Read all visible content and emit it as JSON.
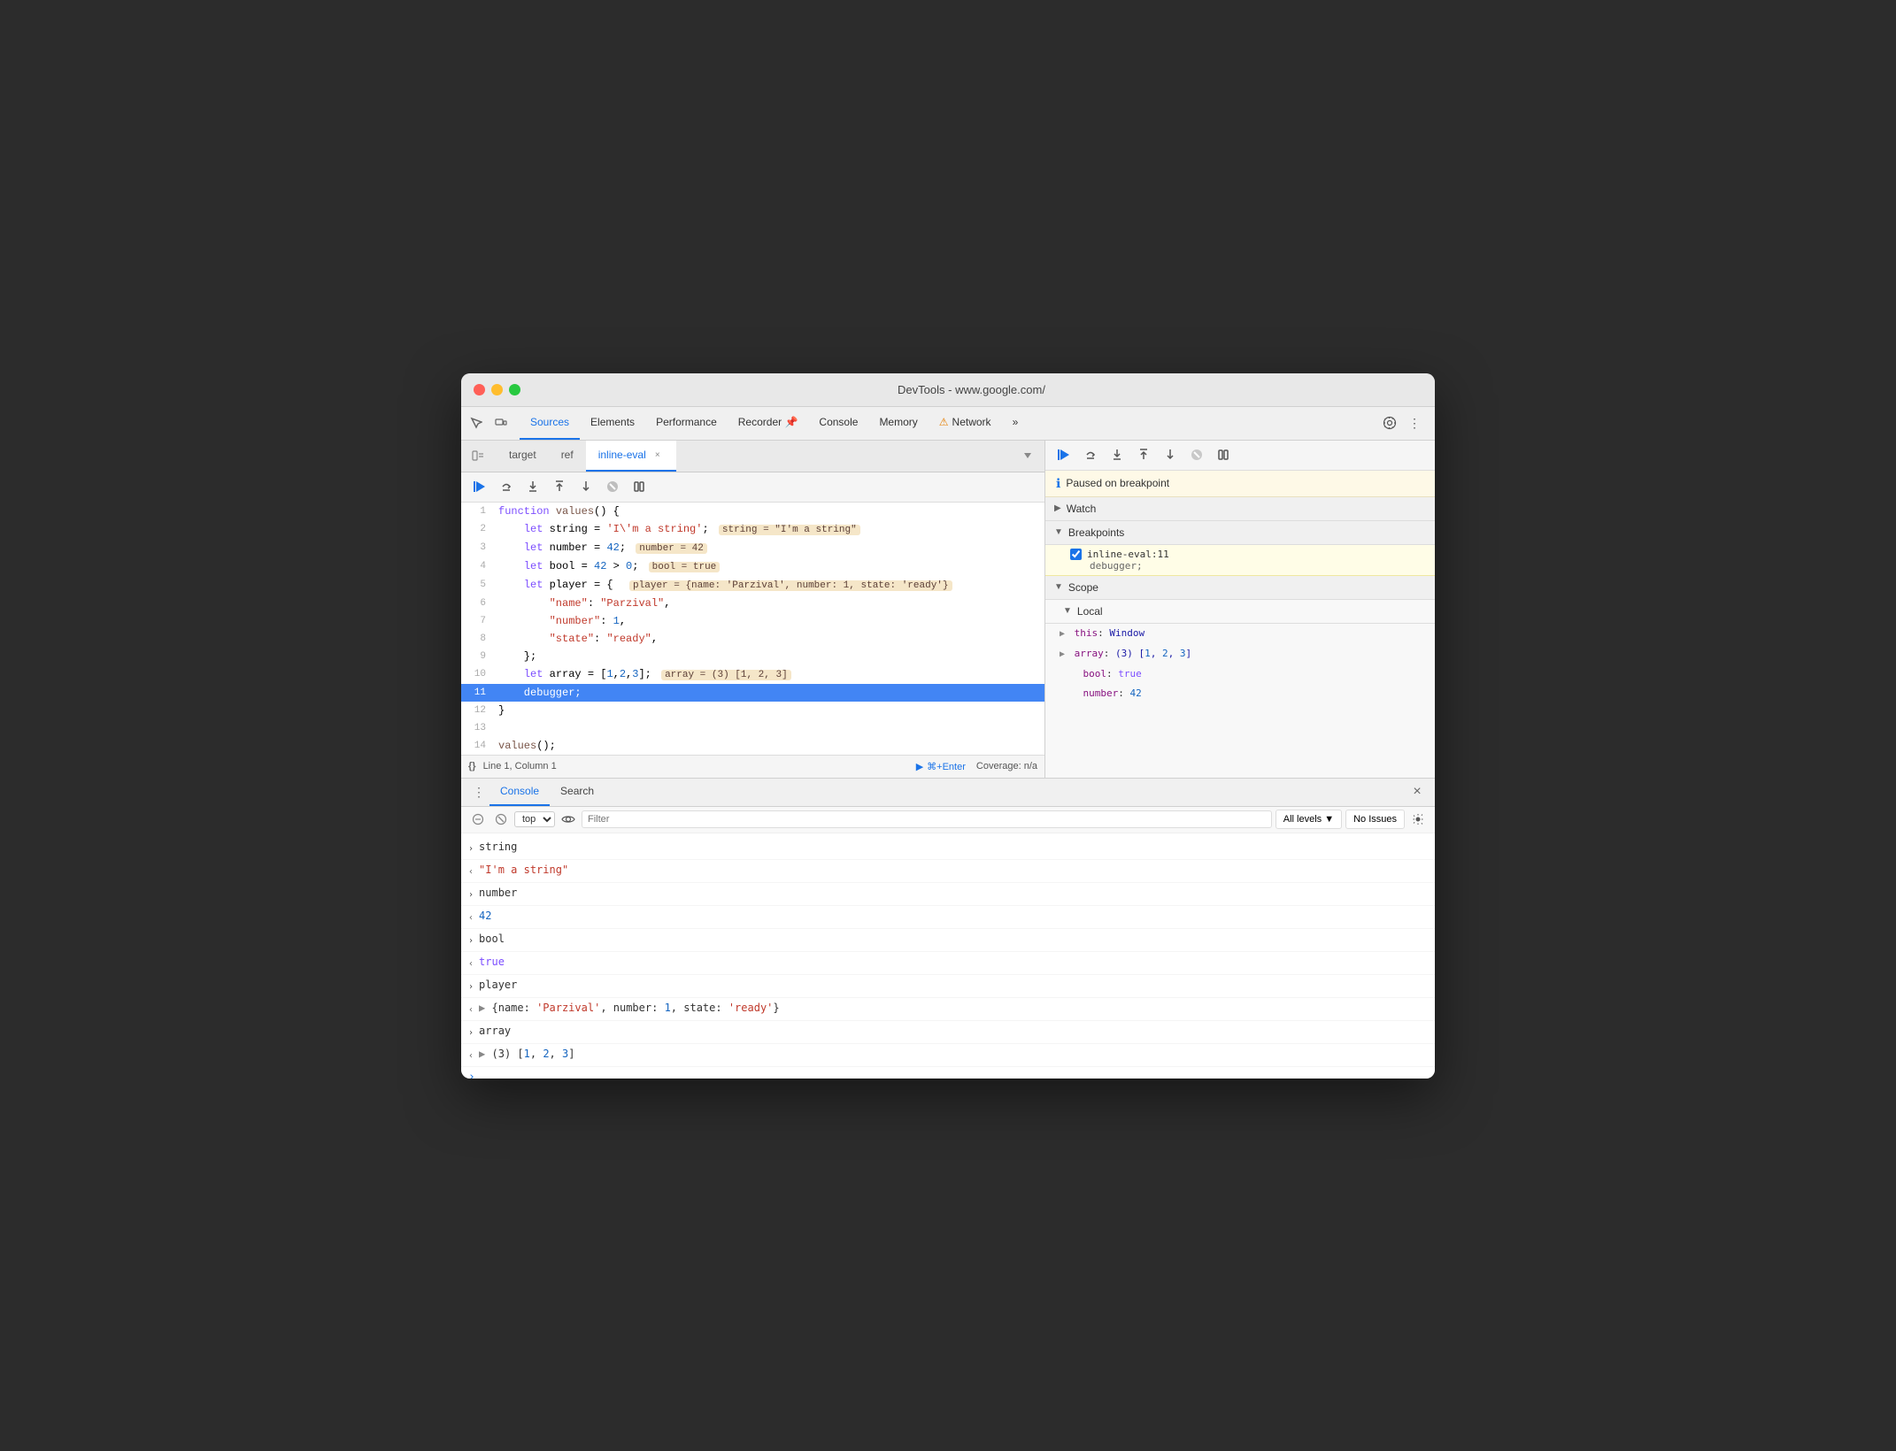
{
  "window": {
    "title": "DevTools - www.google.com/"
  },
  "traffic_lights": {
    "close": "close",
    "minimize": "minimize",
    "maximize": "maximize"
  },
  "devtools_tabs": {
    "items": [
      {
        "label": "Sources",
        "active": true
      },
      {
        "label": "Elements",
        "active": false
      },
      {
        "label": "Performance",
        "active": false
      },
      {
        "label": "Recorder",
        "active": false,
        "icon": "📌"
      },
      {
        "label": "Console",
        "active": false
      },
      {
        "label": "Memory",
        "active": false
      },
      {
        "label": "Network",
        "active": false,
        "warning": true
      },
      {
        "label": "»",
        "active": false
      }
    ]
  },
  "source_tabs": {
    "items": [
      {
        "label": "target",
        "closeable": false
      },
      {
        "label": "ref",
        "closeable": false
      },
      {
        "label": "inline-eval",
        "closeable": true,
        "active": true
      }
    ]
  },
  "debug_toolbar": {
    "resume_label": "Resume",
    "step_over_label": "Step over",
    "step_into_label": "Step into",
    "step_out_label": "Step out",
    "step_label": "Step",
    "deactivate_label": "Deactivate breakpoints",
    "pause_exceptions_label": "Pause on exceptions"
  },
  "code": {
    "lines": [
      {
        "num": 1,
        "content": "function values() {",
        "current": false
      },
      {
        "num": 2,
        "content": "    let string = 'I\\'m a string';",
        "current": false,
        "inline": "string = \"I'm a string\""
      },
      {
        "num": 3,
        "content": "    let number = 42;",
        "current": false,
        "inline": "number = 42"
      },
      {
        "num": 4,
        "content": "    let bool = 42 > 0;",
        "current": false,
        "inline": "bool = true"
      },
      {
        "num": 5,
        "content": "    let player = {  player = {name: 'Parzival', number: 1, state: 'ready'}",
        "current": false
      },
      {
        "num": 6,
        "content": "        \"name\": \"Parzival\",",
        "current": false
      },
      {
        "num": 7,
        "content": "        \"number\": 1,",
        "current": false
      },
      {
        "num": 8,
        "content": "        \"state\": \"ready\",",
        "current": false
      },
      {
        "num": 9,
        "content": "    };",
        "current": false
      },
      {
        "num": 10,
        "content": "    let array = [1,2,3];",
        "current": false,
        "inline": "array = (3) [1, 2, 3]"
      },
      {
        "num": 11,
        "content": "    debugger;",
        "current": true
      },
      {
        "num": 12,
        "content": "}",
        "current": false
      },
      {
        "num": 13,
        "content": "",
        "current": false
      },
      {
        "num": 14,
        "content": "values();",
        "current": false
      }
    ]
  },
  "status_bar": {
    "curly": "{}",
    "position": "Line 1, Column 1",
    "run_label": "⌘+Enter",
    "run_prefix": "▶",
    "coverage": "Coverage: n/a"
  },
  "right_panel": {
    "pause_message": "Paused on breakpoint",
    "watch_label": "Watch",
    "breakpoints_label": "Breakpoints",
    "breakpoint_item": {
      "file": "inline-eval:11",
      "code": "debugger;"
    },
    "scope_label": "Scope",
    "local_label": "Local",
    "scope_items": [
      {
        "key": "this",
        "val": "Window",
        "expandable": true
      },
      {
        "key": "array",
        "val": "(3) [1, 2, 3]",
        "expandable": true
      },
      {
        "key": "bool",
        "val": "true",
        "type": "bool"
      },
      {
        "key": "number",
        "val": "42",
        "type": "num"
      }
    ]
  },
  "bottom_panel": {
    "tabs": [
      {
        "label": "Console",
        "active": true
      },
      {
        "label": "Search",
        "active": false
      }
    ],
    "console_toolbar": {
      "filter_placeholder": "Filter",
      "levels_label": "All levels",
      "no_issues_label": "No Issues"
    },
    "top_selector": "top",
    "console_items": [
      {
        "type": "input",
        "text": "string"
      },
      {
        "type": "output",
        "text": "\"I'm a string\"",
        "color": "string"
      },
      {
        "type": "input",
        "text": "number"
      },
      {
        "type": "output",
        "text": "42",
        "color": "number"
      },
      {
        "type": "input",
        "text": "bool"
      },
      {
        "type": "output",
        "text": "true",
        "color": "bool"
      },
      {
        "type": "input",
        "text": "player"
      },
      {
        "type": "output",
        "text": "▶ {name: 'Parzival', number: 1, state: 'ready'}",
        "color": "obj"
      },
      {
        "type": "input",
        "text": "array"
      },
      {
        "type": "output",
        "text": "▶ (3) [1, 2, 3]",
        "color": "obj"
      }
    ]
  }
}
